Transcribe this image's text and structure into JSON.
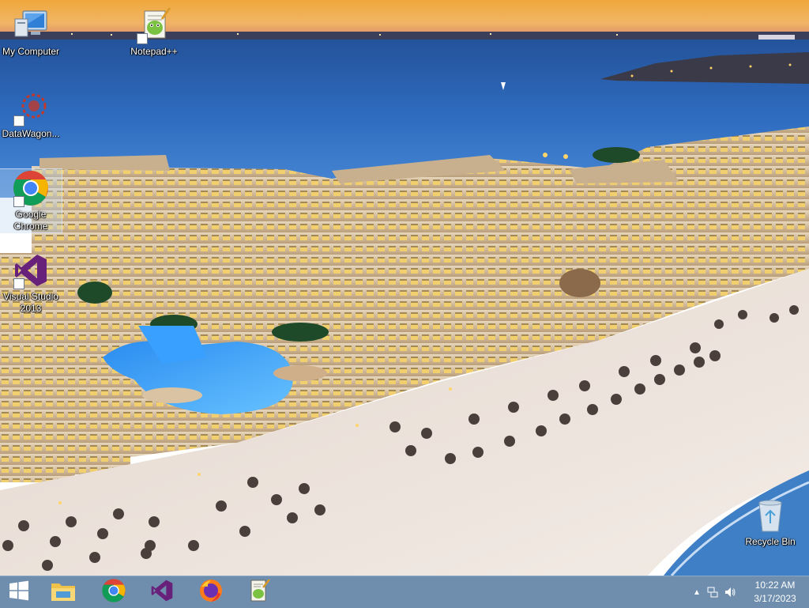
{
  "desktop": {
    "icons": [
      {
        "label": "My Computer"
      },
      {
        "label": "Notepad++"
      },
      {
        "label": "DataWagon..."
      },
      {
        "label": "Google Chrome"
      },
      {
        "label": "Visual Studio 2013"
      },
      {
        "label": "Recycle Bin"
      }
    ]
  },
  "taskbar": {
    "pinned": [
      "windows-start",
      "file-explorer",
      "google-chrome",
      "visual-studio",
      "firefox",
      "notepad-plus-plus"
    ],
    "tray": {
      "time": "10:22 AM",
      "date": "3/17/2023"
    }
  },
  "colors": {
    "taskbar": "#46698f",
    "chrome_red": "#db4437",
    "chrome_yellow": "#f4b400",
    "chrome_green": "#0f9d58",
    "chrome_blue": "#4285f4",
    "vs_purple": "#68217a",
    "selection": "#bed7f0"
  }
}
